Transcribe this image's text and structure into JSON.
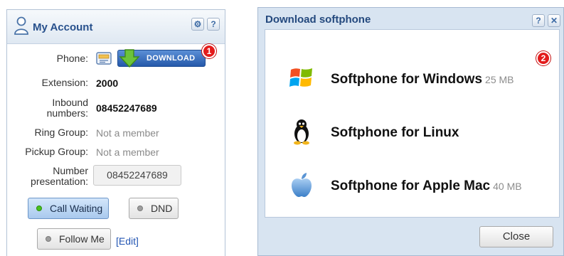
{
  "account": {
    "title": "My Account",
    "phone_label": "Phone:",
    "download_label": "DOWNLOAD",
    "badge1": "1",
    "extension_label": "Extension:",
    "extension_value": "2000",
    "inbound_label_1": "Inbound",
    "inbound_label_2": "numbers:",
    "inbound_value": "08452247689",
    "ring_group_label": "Ring Group:",
    "ring_group_value": "Not a member",
    "pickup_group_label": "Pickup Group:",
    "pickup_group_value": "Not a member",
    "number_label_1": "Number",
    "number_label_2": "presentation:",
    "number_value": "08452247689",
    "call_waiting_label": "Call Waiting",
    "dnd_label": "DND",
    "follow_me_label": "Follow Me",
    "edit_label": "[Edit]",
    "gear_glyph": "⚙",
    "help_glyph": "?"
  },
  "dialog": {
    "title": "Download softphone",
    "badge2": "2",
    "help_glyph": "?",
    "close_glyph": "✕",
    "items": [
      {
        "label": "Softphone for Windows",
        "size": "25 MB",
        "icon": "windows-logo"
      },
      {
        "label": "Softphone for Linux",
        "size": "",
        "icon": "linux-penguin"
      },
      {
        "label": "Softphone for Apple Mac",
        "size": "40 MB",
        "icon": "apple-logo"
      }
    ],
    "close_label": "Close"
  },
  "colors": {
    "accent": "#27508c",
    "badge": "#e31b1b",
    "download": "#2559aa"
  }
}
